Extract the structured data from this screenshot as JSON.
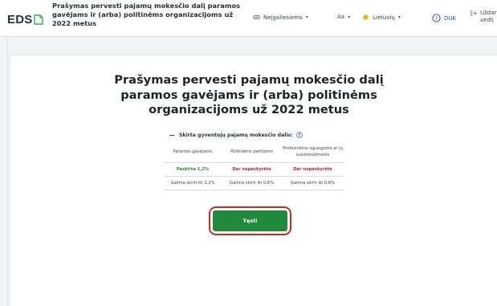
{
  "header": {
    "logo_text": "EDS",
    "app_title": "Prašymas pervesti pajamų mokesčio dalį paramos gavėjams ir (arba) politinėms organizacijoms už 2022 metus",
    "accessibility_label": "Neįgaliesiems",
    "font_label": "Aa",
    "language_label": "Lietuvių",
    "help_label": "DUK",
    "exit_label": "Uždaryti vedlį"
  },
  "main": {
    "heading": "Prašymas pervesti pajamų mokesčio dalį paramos gavėjams ir (arba) politinėms organizacijoms už 2022 metus",
    "section_label": "Skirta gyventojų pajamų mokesčio dalis:",
    "table": {
      "columns": [
        "Paramos gavėjams",
        "Politinėms partijoms",
        "Profesinėms sąjungoms ar jų susivienijimams"
      ],
      "status": [
        "Paskirta 1,2%",
        "Dar nepaskyrėte",
        "Dar nepaskyrėte"
      ],
      "limits": [
        "Galima skirti iki 1,2%",
        "Galima skirti iki 0,6%",
        "Galima skirti iki 0,6%"
      ]
    },
    "continue_button": "Tęsti"
  },
  "colors": {
    "accent_green": "#1f8a3b",
    "status_ok": "#2e8b2e",
    "status_pending": "#d21d1d",
    "highlight_ring": "#d6261c",
    "help_blue": "#1f5fa8"
  },
  "icons": [
    "document-icon",
    "accessibility-icon",
    "globe-icon",
    "help-icon",
    "exit-icon",
    "question-icon"
  ]
}
